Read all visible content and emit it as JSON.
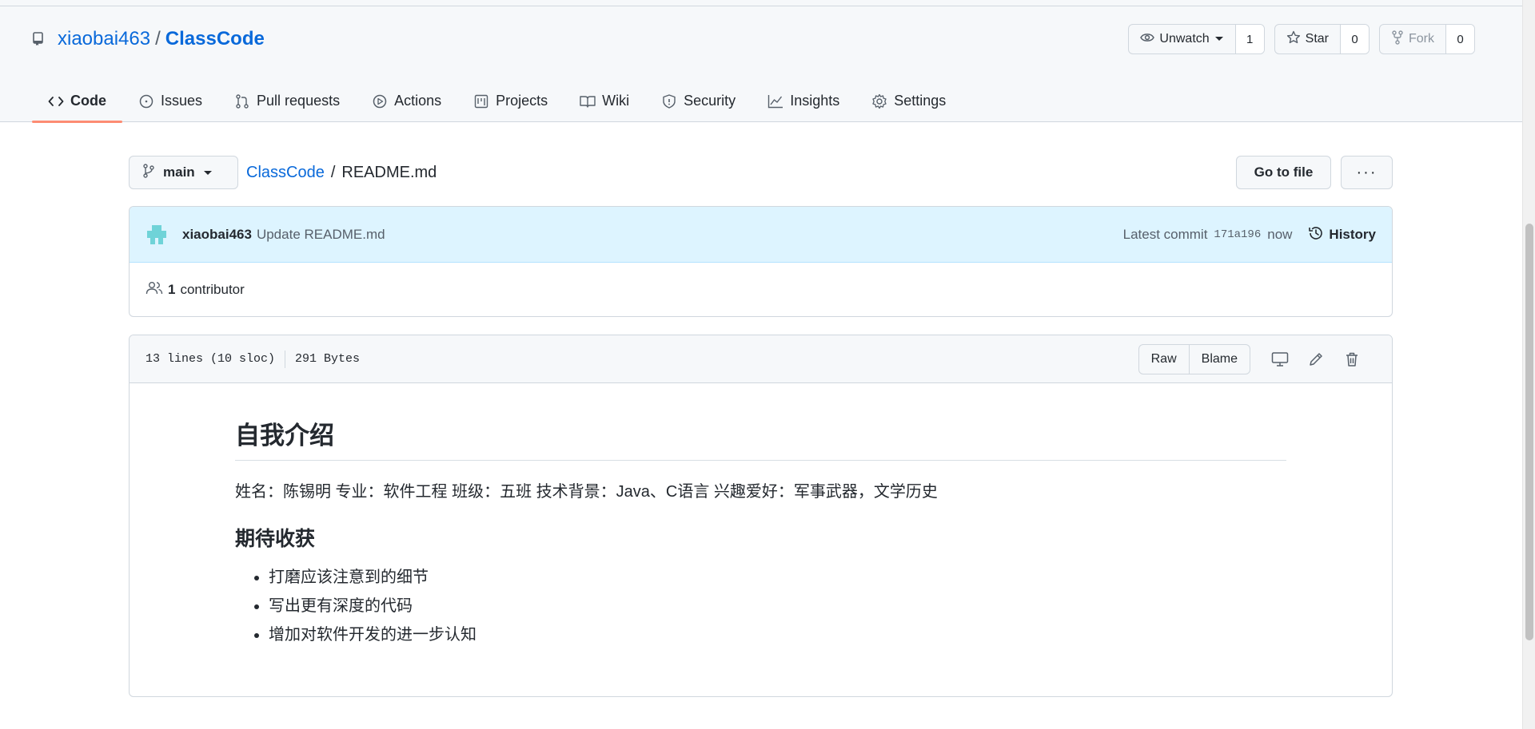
{
  "repo": {
    "owner": "xiaobai463",
    "separator": "/",
    "name": "ClassCode",
    "icon": "repo-icon"
  },
  "actions": {
    "watch": {
      "label": "Unwatch",
      "count": "1",
      "icon": "eye-icon"
    },
    "star": {
      "label": "Star",
      "count": "0",
      "icon": "star-icon"
    },
    "fork": {
      "label": "Fork",
      "count": "0",
      "icon": "fork-icon"
    }
  },
  "tabs": [
    {
      "label": "Code",
      "icon": "code-icon",
      "active": true
    },
    {
      "label": "Issues",
      "icon": "issue-icon"
    },
    {
      "label": "Pull requests",
      "icon": "pull-request-icon"
    },
    {
      "label": "Actions",
      "icon": "play-icon"
    },
    {
      "label": "Projects",
      "icon": "project-icon"
    },
    {
      "label": "Wiki",
      "icon": "book-icon"
    },
    {
      "label": "Security",
      "icon": "shield-icon"
    },
    {
      "label": "Insights",
      "icon": "graph-icon"
    },
    {
      "label": "Settings",
      "icon": "gear-icon"
    }
  ],
  "breadcrumb": {
    "branch": "main",
    "repo_link": "ClassCode",
    "separator": "/",
    "file": "README.md",
    "goto_label": "Go to file",
    "more_label": "···"
  },
  "commit": {
    "author": "xiaobai463",
    "message": "Update README.md",
    "latest_label": "Latest commit",
    "sha": "171a196",
    "time": "now",
    "history_label": "History"
  },
  "contributors": {
    "count": "1",
    "label": "contributor"
  },
  "file": {
    "lines": "13 lines (10 sloc)",
    "size": "291 Bytes",
    "raw_label": "Raw",
    "blame_label": "Blame"
  },
  "readme": {
    "h1": "自我介绍",
    "intro": "姓名：陈锡明   专业：软件工程   班级：五班   技术背景：Java、C语言   兴趣爱好：军事武器，文学历史",
    "h2": "期待收获",
    "items": [
      "打磨应该注意到的细节",
      "写出更有深度的代码",
      "增加对软件开发的进一步认知"
    ]
  },
  "colors": {
    "link": "#0969da",
    "active_tab_underline": "#fd8c73",
    "commit_bg": "#ddf4ff",
    "avatar": "#6fd3d8"
  }
}
